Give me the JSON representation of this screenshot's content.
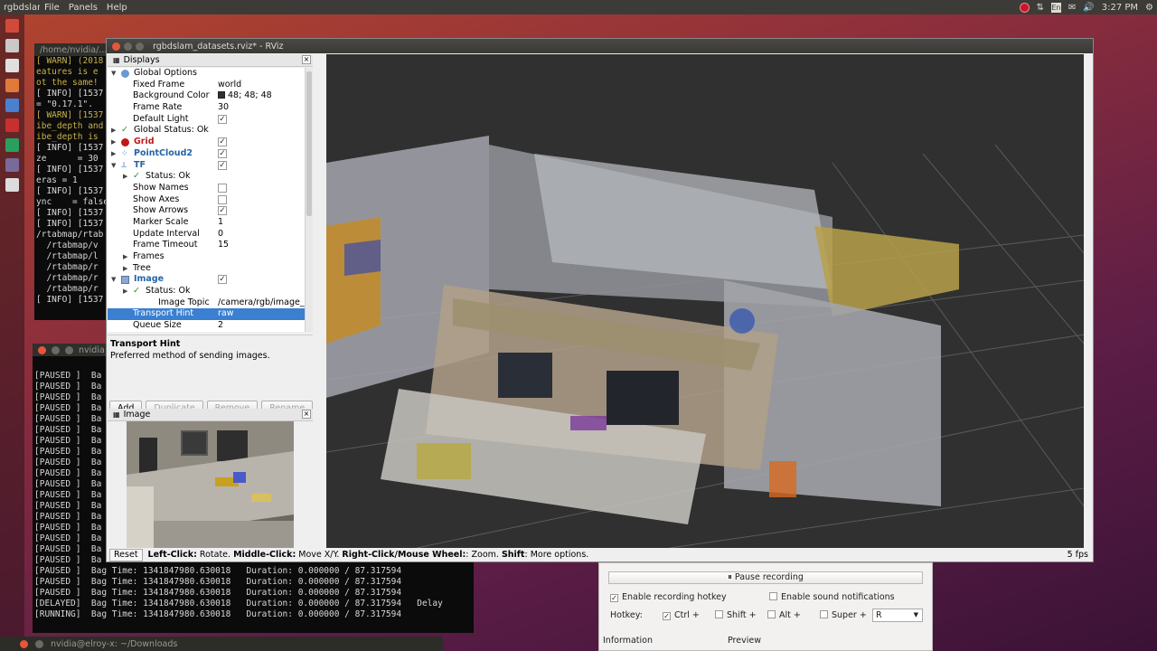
{
  "topbar": {
    "app_name": "rgbdslam_datasets.rviz* - RViz",
    "menus": [
      "File",
      "Panels",
      "Help"
    ],
    "lang": "En",
    "time": "3:27 PM"
  },
  "terminal1": {
    "title": "/home/nvidia/...",
    "lines": [
      "[ WARN] (2018",
      "eatures is e",
      "ot the same!",
      "[ INFO] [1537",
      "= \"0.17.1\".",
      "[ WARN] [1537",
      "ibe_depth and",
      "ibe_depth is",
      "[ INFO] [1537",
      "ze      = 30",
      "[ INFO] [1537",
      "eras = 1",
      "[ INFO] [1537",
      "ync    = false",
      "[ INFO] [1537",
      "[ INFO] [1537",
      "/rtabmap/rtab",
      "  /rtabmap/v",
      "  /rtabmap/l",
      "  /rtabmap/r",
      "  /rtabmap/r",
      "  /rtabmap/r",
      "[ INFO] [1537"
    ]
  },
  "terminal2": {
    "title": "nvidia",
    "paused_lines": [
      "[PAUSED ]  Ba",
      "[PAUSED ]  Ba",
      "[PAUSED ]  Ba",
      "[PAUSED ]  Ba",
      "[PAUSED ]  Ba",
      "[PAUSED ]  Ba",
      "[PAUSED ]  Ba",
      "[PAUSED ]  Ba",
      "[PAUSED ]  Ba",
      "[PAUSED ]  Ba",
      "[PAUSED ]  Ba",
      "[PAUSED ]  Ba",
      "[PAUSED ]  Ba",
      "[PAUSED ]  Ba",
      "[PAUSED ]  Ba",
      "[PAUSED ]  Ba",
      "[PAUSED ]  Ba",
      "[PAUSED ]  Ba"
    ],
    "full_lines": [
      "[PAUSED ]  Bag Time: 1341847980.630018   Duration: 0.000000 / 87.317594",
      "[PAUSED ]  Bag Time: 1341847980.630018   Duration: 0.000000 / 87.317594",
      "[PAUSED ]  Bag Time: 1341847980.630018   Duration: 0.000000 / 87.317594",
      "[DELAYED]  Bag Time: 1341847980.630018   Duration: 0.000000 / 87.317594   Delay",
      "[RUNNING]  Bag Time: 1341847980.630018   Duration: 0.000000 / 87.317594"
    ]
  },
  "bottombar": {
    "title": "nvidia@elroy-x: ~/Downloads"
  },
  "rviz": {
    "title": "rgbdslam_datasets.rviz* - RViz",
    "displays_title": "Displays",
    "rows": {
      "global_options": "Global Options",
      "fixed_frame": "Fixed Frame",
      "fixed_frame_val": "world",
      "bg_color": "Background Color",
      "bg_color_val": "48; 48; 48",
      "frame_rate": "Frame Rate",
      "frame_rate_val": "30",
      "default_light": "Default Light",
      "global_status": "Global Status: Ok",
      "grid": "Grid",
      "pointcloud2": "PointCloud2",
      "tf": "TF",
      "status_ok": "Status: Ok",
      "show_names": "Show Names",
      "show_axes": "Show Axes",
      "show_arrows": "Show Arrows",
      "marker_scale": "Marker Scale",
      "marker_scale_val": "1",
      "update_interval": "Update Interval",
      "update_interval_val": "0",
      "frame_timeout": "Frame Timeout",
      "frame_timeout_val": "15",
      "frames": "Frames",
      "tree": "Tree",
      "image": "Image",
      "image_status": "Status: Ok",
      "image_topic": "Image Topic",
      "image_topic_val": "/camera/rgb/image_",
      "transport_hint": "Transport Hint",
      "transport_hint_val": "raw",
      "queue_size": "Queue Size",
      "queue_size_val": "2"
    },
    "desc_title": "Transport Hint",
    "desc_text": "Preferred method of sending images.",
    "buttons": {
      "add": "Add",
      "duplicate": "Duplicate",
      "remove": "Remove",
      "rename": "Rename"
    },
    "image_panel_title": "Image",
    "status": {
      "reset": "Reset",
      "l1": "Left-Click:",
      "t1": " Rotate. ",
      "l2": "Middle-Click:",
      "t2": " Move X/Y. ",
      "l3": "Right-Click/Mouse Wheel:",
      "t3": ": Zoom. ",
      "l4": "Shift",
      "t4": ": More options.",
      "fps": "5 fps"
    },
    "background_color": "#303030"
  },
  "recorder": {
    "pause": "Pause recording",
    "enable_hotkey": "Enable recording hotkey",
    "enable_sound": "Enable sound notifications",
    "hotkey_label": "Hotkey:",
    "ctrl": "Ctrl +",
    "shift": "Shift +",
    "alt": "Alt +",
    "super": "Super +",
    "key": "R",
    "information": "Information",
    "preview": "Preview"
  }
}
